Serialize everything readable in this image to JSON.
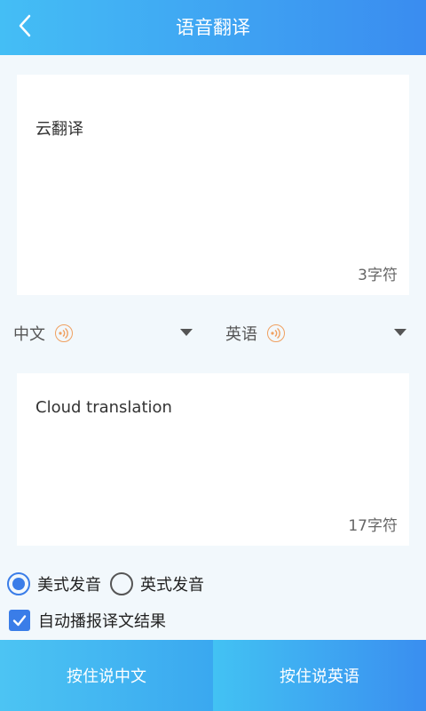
{
  "header": {
    "title": "语音翻译",
    "back_icon": "chevron-left-icon"
  },
  "source": {
    "text": "云翻译",
    "char_count": "3字符"
  },
  "languages": {
    "source_label": "中文",
    "target_label": "英语",
    "speaker_icon": "speaker-icon",
    "dropdown_icon": "caret-down-icon"
  },
  "target": {
    "text": "Cloud translation",
    "char_count": "17字符"
  },
  "pronunciation": {
    "options": [
      {
        "label": "美式发音",
        "selected": true
      },
      {
        "label": "英式发音",
        "selected": false
      }
    ]
  },
  "auto_play": {
    "label": "自动播报译文结果",
    "checked": true
  },
  "bottom": {
    "left_label": "按住说中文",
    "right_label": "按住说英语"
  },
  "colors": {
    "header_from": "#44bef5",
    "header_to": "#3a8cf0",
    "accent": "#3a7de8",
    "speaker": "#f0a060",
    "background": "#f2f8fc"
  }
}
